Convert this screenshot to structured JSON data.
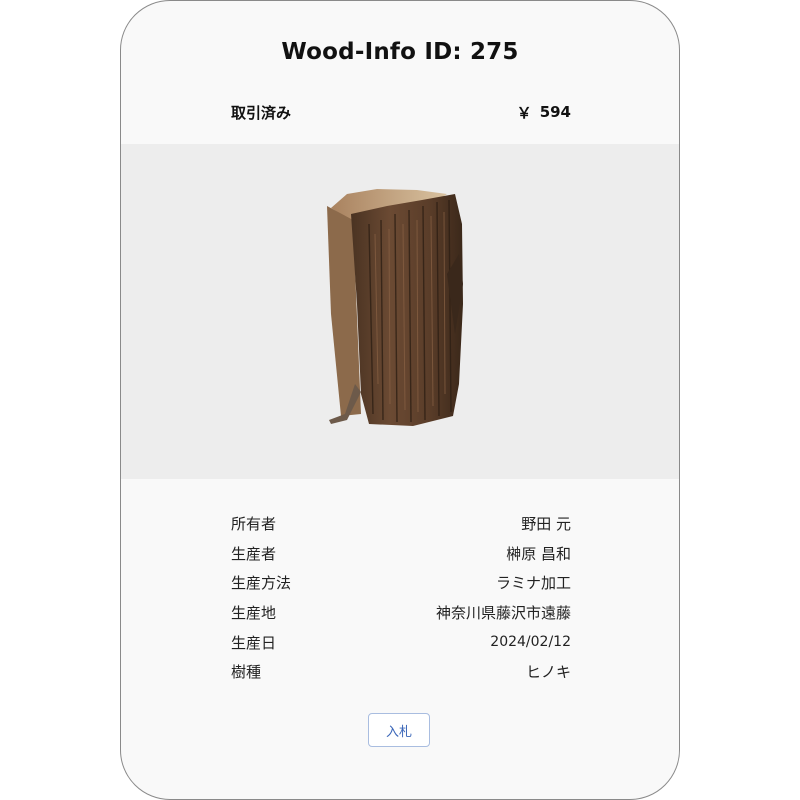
{
  "card": {
    "title": "Wood-Info ID: 275",
    "status": "取引済み",
    "currency_symbol": "￥",
    "price": "594",
    "image_alt": "log-photo"
  },
  "info": {
    "rows": [
      {
        "label": "所有者",
        "value": "野田 元"
      },
      {
        "label": "生産者",
        "value": "榊原 昌和"
      },
      {
        "label": "生産方法",
        "value": "ラミナ加工"
      },
      {
        "label": "生産地",
        "value": "神奈川県藤沢市遠藤"
      },
      {
        "label": "生産日",
        "value": "2024/02/12"
      },
      {
        "label": "樹種",
        "value": "ヒノキ"
      }
    ]
  },
  "actions": {
    "bid_label": "入札"
  },
  "colors": {
    "card_background": "#f9f9f9",
    "image_background": "#ededed",
    "button_text": "#3a66b8",
    "button_border": "#a9bde0"
  }
}
